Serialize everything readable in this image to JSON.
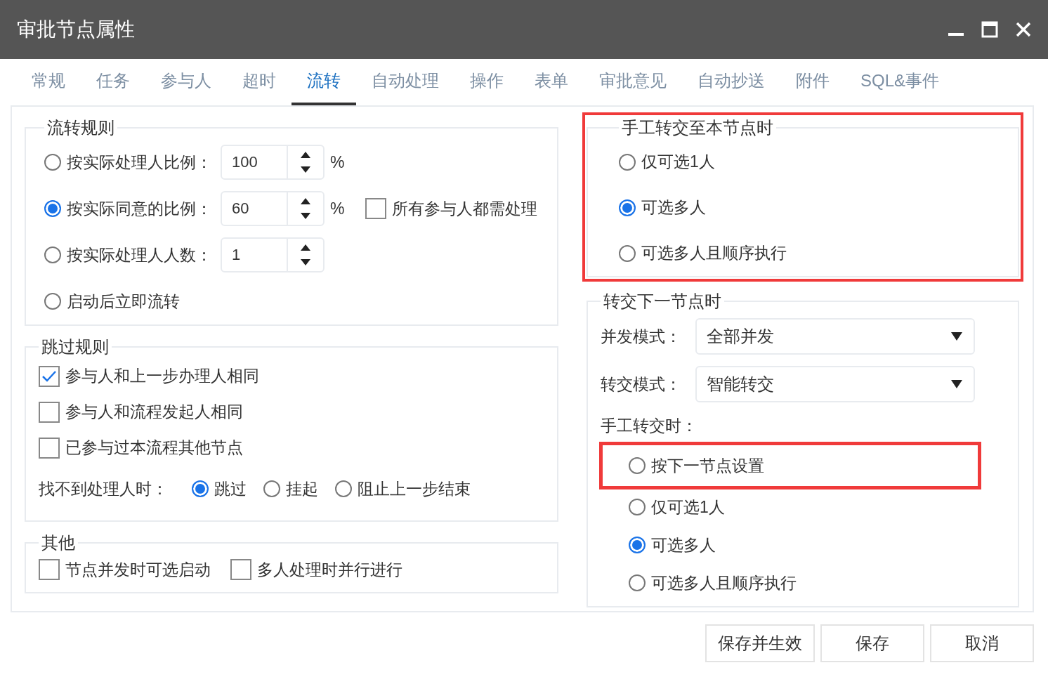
{
  "window": {
    "title": "审批节点属性"
  },
  "tabs": [
    {
      "label": "常规",
      "selected": false
    },
    {
      "label": "任务",
      "selected": false
    },
    {
      "label": "参与人",
      "selected": false
    },
    {
      "label": "超时",
      "selected": false
    },
    {
      "label": "流转",
      "selected": true
    },
    {
      "label": "自动处理",
      "selected": false
    },
    {
      "label": "操作",
      "selected": false
    },
    {
      "label": "表单",
      "selected": false
    },
    {
      "label": "审批意见",
      "selected": false
    },
    {
      "label": "自动抄送",
      "selected": false
    },
    {
      "label": "附件",
      "selected": false
    },
    {
      "label": "SQL&事件",
      "selected": false
    }
  ],
  "flow_rules": {
    "title": "流转规则",
    "options": [
      {
        "kind": "spinner",
        "label": "按实际处理人比例：",
        "selected": false,
        "value": "100",
        "unit": "%"
      },
      {
        "kind": "spinner",
        "label": "按实际同意的比例：",
        "selected": true,
        "value": "60",
        "unit": "%",
        "extra": {
          "label": "所有参与人都需处理",
          "checked": false
        }
      },
      {
        "kind": "spinner",
        "label": "按实际处理人人数：",
        "selected": false,
        "value": "1"
      },
      {
        "kind": "plain",
        "label": "启动后立即流转",
        "selected": false
      }
    ]
  },
  "skip_rules": {
    "title": "跳过规则",
    "checks": [
      {
        "label": "参与人和上一步办理人相同",
        "checked": true
      },
      {
        "label": "参与人和流程发起人相同",
        "checked": false
      },
      {
        "label": "已参与过本流程其他节点",
        "checked": false
      }
    ],
    "no_handler": {
      "label": "找不到处理人时：",
      "options": [
        {
          "label": "跳过",
          "selected": true
        },
        {
          "label": "挂起",
          "selected": false
        },
        {
          "label": "阻止上一步结束",
          "selected": false
        }
      ]
    }
  },
  "other": {
    "title": "其他",
    "checks": [
      {
        "label": "节点并发时可选启动",
        "checked": false
      },
      {
        "label": "多人处理时并行进行",
        "checked": false
      }
    ]
  },
  "manual_to_this": {
    "title": "手工转交至本节点时",
    "highlighted": true,
    "options": [
      {
        "label": "仅可选1人",
        "selected": false
      },
      {
        "label": "可选多人",
        "selected": true
      },
      {
        "label": "可选多人且顺序执行",
        "selected": false
      }
    ]
  },
  "to_next": {
    "title": "转交下一节点时",
    "selects": [
      {
        "label": "并发模式：",
        "value": "全部并发"
      },
      {
        "label": "转交模式：",
        "value": "智能转交"
      }
    ],
    "manual_label": "手工转交时：",
    "options": [
      {
        "label": "按下一节点设置",
        "selected": false,
        "highlighted": true
      },
      {
        "label": "仅可选1人",
        "selected": false,
        "highlighted": false
      },
      {
        "label": "可选多人",
        "selected": true,
        "highlighted": false
      },
      {
        "label": "可选多人且顺序执行",
        "selected": false,
        "highlighted": false
      }
    ]
  },
  "buttons": [
    "保存并生效",
    "保存",
    "取消"
  ]
}
